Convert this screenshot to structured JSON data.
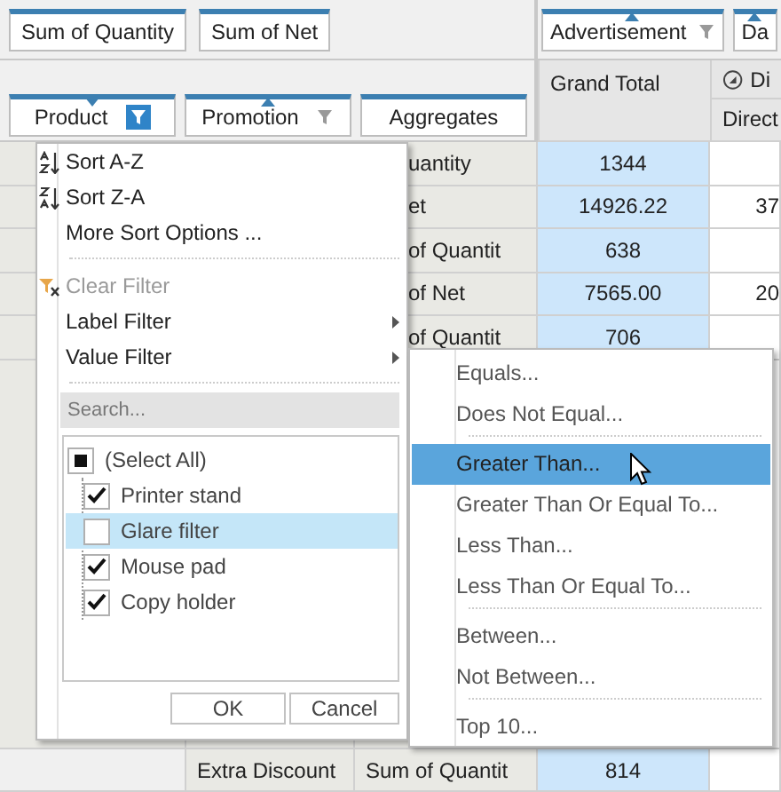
{
  "filter_area": {
    "chips": [
      {
        "label": "Sum of Quantity",
        "sorted": false,
        "kind": "plain"
      },
      {
        "label": "Sum of Net",
        "sorted": false,
        "kind": "plain"
      }
    ]
  },
  "column_area": {
    "chips": [
      {
        "label": "Advertisement",
        "sorted": true,
        "descending": false,
        "kind": "filterable",
        "filtered": false
      },
      {
        "label": "Da",
        "sorted": true,
        "descending": false,
        "kind": "plain"
      }
    ]
  },
  "row_area": {
    "chips": [
      {
        "label": "Product",
        "sorted": true,
        "descending": true,
        "kind": "filterable",
        "filtered": true
      },
      {
        "label": "Promotion",
        "sorted": true,
        "descending": false,
        "kind": "filterable",
        "filtered": false
      },
      {
        "label": "Aggregates",
        "sorted": false,
        "kind": "plain"
      }
    ]
  },
  "grid": {
    "headers": {
      "grand_total": "Grand Total",
      "column_5": "Di",
      "column_5_sub": "Direct"
    },
    "rows": [
      {
        "label_2": "uantity",
        "grand_total": "1344"
      },
      {
        "label_2": "et",
        "grand_total": "14926.22",
        "column_5": "37"
      },
      {
        "label_2": "of Quantit",
        "grand_total": "638"
      },
      {
        "label_2": "of Net",
        "grand_total": "7565.00",
        "column_5": "20"
      },
      {
        "label_2": "of Quantit",
        "grand_total": "706"
      }
    ],
    "bottom_row": {
      "label_1": "Extra Discount",
      "label_2": "Sum of Quantit",
      "grand_total": "814"
    }
  },
  "product_menu": {
    "items": [
      {
        "kind": "sortup",
        "label": "Sort A-Z",
        "disabled": false
      },
      {
        "kind": "sortdown",
        "label": "Sort Z-A",
        "disabled": false
      },
      {
        "kind": "command",
        "label": "More Sort Options ...",
        "disabled": false
      },
      {
        "kind": "separator"
      },
      {
        "kind": "clear",
        "label": "Clear Filter",
        "disabled": true
      },
      {
        "kind": "submenu",
        "label": "Label Filter",
        "disabled": false
      },
      {
        "kind": "submenu",
        "label": "Value Filter",
        "disabled": false
      },
      {
        "kind": "separator"
      }
    ],
    "search": {
      "placeholder": "Search..."
    },
    "values": [
      {
        "label": "(Select All)",
        "checked": false,
        "indeterminate": true,
        "selected": false,
        "children": [
          {
            "label": "Printer stand",
            "checked": true,
            "selected": false
          },
          {
            "label": "Glare filter",
            "checked": false,
            "selected": true
          },
          {
            "label": "Mouse pad",
            "checked": true,
            "selected": false
          },
          {
            "label": "Copy holder",
            "checked": true,
            "selected": false
          }
        ]
      }
    ],
    "buttons": [
      "OK",
      "Cancel"
    ]
  },
  "value_filter_submenu": {
    "items": [
      {
        "kind": "command",
        "label": "Equals...",
        "selected": false
      },
      {
        "kind": "command",
        "label": "Does Not Equal...",
        "selected": false
      },
      {
        "kind": "separator"
      },
      {
        "kind": "command",
        "label": "Greater Than...",
        "selected": true
      },
      {
        "kind": "command",
        "label": "Greater Than Or Equal To...",
        "selected": false
      },
      {
        "kind": "command",
        "label": "Less Than...",
        "selected": false
      },
      {
        "kind": "command",
        "label": "Less Than Or Equal To...",
        "selected": false
      },
      {
        "kind": "separator"
      },
      {
        "kind": "command",
        "label": "Between...",
        "selected": false
      },
      {
        "kind": "command",
        "label": "Not Between...",
        "selected": false
      },
      {
        "kind": "separator"
      },
      {
        "kind": "command",
        "label": "Top 10...",
        "selected": false
      }
    ]
  }
}
